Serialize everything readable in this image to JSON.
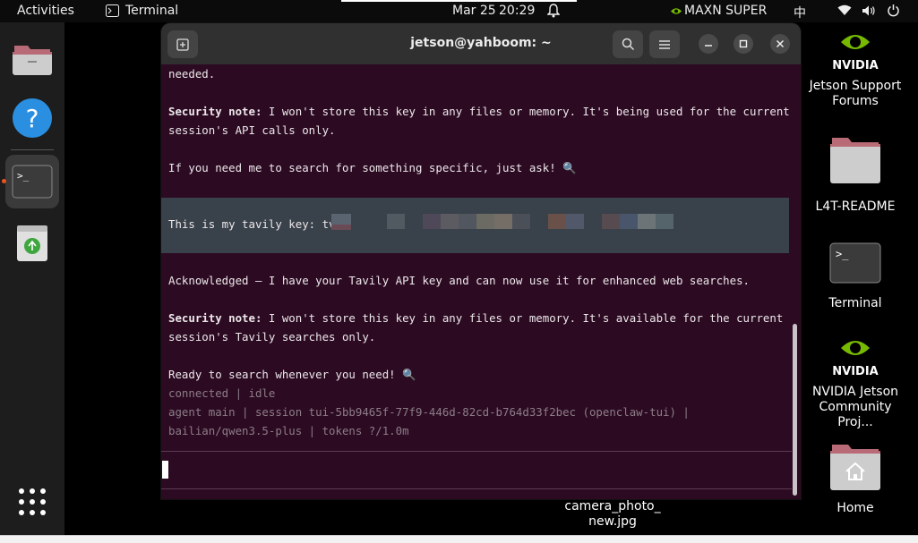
{
  "topbar": {
    "activities": "Activities",
    "app_name": "Terminal",
    "date": "Mar 25",
    "time": "20:29",
    "power_mode": "MAXN SUPER",
    "input_method": "中"
  },
  "desktop": {
    "icons": [
      {
        "label_line1": "Jetson Support",
        "label_line2": "Forums"
      },
      {
        "label_line1": "L4T-README",
        "label_line2": ""
      },
      {
        "label_line1": "Terminal",
        "label_line2": ""
      },
      {
        "label_line1": "NVIDIA Jetson",
        "label_line2": "Community Proj..."
      },
      {
        "label_line1": "Home",
        "label_line2": ""
      },
      {
        "label_line1": "camera_photo_",
        "label_line2": "new.jpg"
      }
    ],
    "nvidia_logo_text": "NVIDIA"
  },
  "terminal": {
    "title": "jetson@yahboom: ~",
    "lines": {
      "l1": "needed.",
      "l2_bold": "Security note:",
      "l2_rest": " I won't store this key in any files or memory. It's being used for the current",
      "l3": "session's API calls only.",
      "l4": "If you need me to search for something specific, just ask! 🔍",
      "user_msg": "This is my tavily key: tvl",
      "l5": "Acknowledged — I have your Tavily API key and can now use it for enhanced web searches.",
      "l6_bold": "Security note:",
      "l6_rest": " I won't store this key in any files or memory. It's available for the current",
      "l7": "session's Tavily searches only.",
      "l8": "Ready to search whenever you need! 🔍",
      "status1": "connected | idle",
      "status2": "agent main | session tui-5bb9465f-77f9-446d-82cd-b764d33f2bec (openclaw-tui) |",
      "status3": "bailian/qwen3.5-plus | tokens ?/1.0m"
    }
  },
  "colors": {
    "terminal_bg": "#2c0a22",
    "user_block_bg": "#39414a",
    "header_bg": "#303030",
    "dock_bg": "#1d1d1d"
  }
}
